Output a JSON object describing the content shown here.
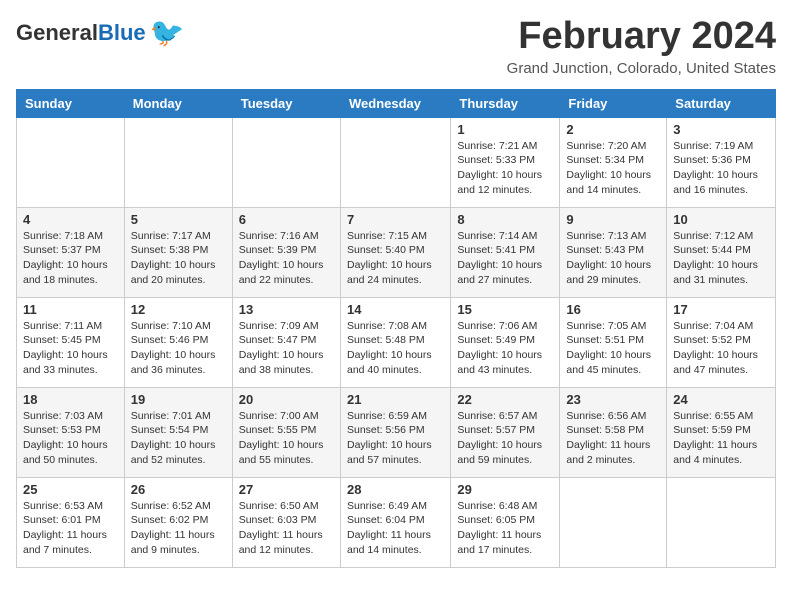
{
  "logo": {
    "general": "General",
    "blue": "Blue"
  },
  "title": {
    "month_year": "February 2024",
    "location": "Grand Junction, Colorado, United States"
  },
  "weekdays": [
    "Sunday",
    "Monday",
    "Tuesday",
    "Wednesday",
    "Thursday",
    "Friday",
    "Saturday"
  ],
  "weeks": [
    [
      {
        "day": "",
        "info": ""
      },
      {
        "day": "",
        "info": ""
      },
      {
        "day": "",
        "info": ""
      },
      {
        "day": "",
        "info": ""
      },
      {
        "day": "1",
        "info": "Sunrise: 7:21 AM\nSunset: 5:33 PM\nDaylight: 10 hours\nand 12 minutes."
      },
      {
        "day": "2",
        "info": "Sunrise: 7:20 AM\nSunset: 5:34 PM\nDaylight: 10 hours\nand 14 minutes."
      },
      {
        "day": "3",
        "info": "Sunrise: 7:19 AM\nSunset: 5:36 PM\nDaylight: 10 hours\nand 16 minutes."
      }
    ],
    [
      {
        "day": "4",
        "info": "Sunrise: 7:18 AM\nSunset: 5:37 PM\nDaylight: 10 hours\nand 18 minutes."
      },
      {
        "day": "5",
        "info": "Sunrise: 7:17 AM\nSunset: 5:38 PM\nDaylight: 10 hours\nand 20 minutes."
      },
      {
        "day": "6",
        "info": "Sunrise: 7:16 AM\nSunset: 5:39 PM\nDaylight: 10 hours\nand 22 minutes."
      },
      {
        "day": "7",
        "info": "Sunrise: 7:15 AM\nSunset: 5:40 PM\nDaylight: 10 hours\nand 24 minutes."
      },
      {
        "day": "8",
        "info": "Sunrise: 7:14 AM\nSunset: 5:41 PM\nDaylight: 10 hours\nand 27 minutes."
      },
      {
        "day": "9",
        "info": "Sunrise: 7:13 AM\nSunset: 5:43 PM\nDaylight: 10 hours\nand 29 minutes."
      },
      {
        "day": "10",
        "info": "Sunrise: 7:12 AM\nSunset: 5:44 PM\nDaylight: 10 hours\nand 31 minutes."
      }
    ],
    [
      {
        "day": "11",
        "info": "Sunrise: 7:11 AM\nSunset: 5:45 PM\nDaylight: 10 hours\nand 33 minutes."
      },
      {
        "day": "12",
        "info": "Sunrise: 7:10 AM\nSunset: 5:46 PM\nDaylight: 10 hours\nand 36 minutes."
      },
      {
        "day": "13",
        "info": "Sunrise: 7:09 AM\nSunset: 5:47 PM\nDaylight: 10 hours\nand 38 minutes."
      },
      {
        "day": "14",
        "info": "Sunrise: 7:08 AM\nSunset: 5:48 PM\nDaylight: 10 hours\nand 40 minutes."
      },
      {
        "day": "15",
        "info": "Sunrise: 7:06 AM\nSunset: 5:49 PM\nDaylight: 10 hours\nand 43 minutes."
      },
      {
        "day": "16",
        "info": "Sunrise: 7:05 AM\nSunset: 5:51 PM\nDaylight: 10 hours\nand 45 minutes."
      },
      {
        "day": "17",
        "info": "Sunrise: 7:04 AM\nSunset: 5:52 PM\nDaylight: 10 hours\nand 47 minutes."
      }
    ],
    [
      {
        "day": "18",
        "info": "Sunrise: 7:03 AM\nSunset: 5:53 PM\nDaylight: 10 hours\nand 50 minutes."
      },
      {
        "day": "19",
        "info": "Sunrise: 7:01 AM\nSunset: 5:54 PM\nDaylight: 10 hours\nand 52 minutes."
      },
      {
        "day": "20",
        "info": "Sunrise: 7:00 AM\nSunset: 5:55 PM\nDaylight: 10 hours\nand 55 minutes."
      },
      {
        "day": "21",
        "info": "Sunrise: 6:59 AM\nSunset: 5:56 PM\nDaylight: 10 hours\nand 57 minutes."
      },
      {
        "day": "22",
        "info": "Sunrise: 6:57 AM\nSunset: 5:57 PM\nDaylight: 10 hours\nand 59 minutes."
      },
      {
        "day": "23",
        "info": "Sunrise: 6:56 AM\nSunset: 5:58 PM\nDaylight: 11 hours\nand 2 minutes."
      },
      {
        "day": "24",
        "info": "Sunrise: 6:55 AM\nSunset: 5:59 PM\nDaylight: 11 hours\nand 4 minutes."
      }
    ],
    [
      {
        "day": "25",
        "info": "Sunrise: 6:53 AM\nSunset: 6:01 PM\nDaylight: 11 hours\nand 7 minutes."
      },
      {
        "day": "26",
        "info": "Sunrise: 6:52 AM\nSunset: 6:02 PM\nDaylight: 11 hours\nand 9 minutes."
      },
      {
        "day": "27",
        "info": "Sunrise: 6:50 AM\nSunset: 6:03 PM\nDaylight: 11 hours\nand 12 minutes."
      },
      {
        "day": "28",
        "info": "Sunrise: 6:49 AM\nSunset: 6:04 PM\nDaylight: 11 hours\nand 14 minutes."
      },
      {
        "day": "29",
        "info": "Sunrise: 6:48 AM\nSunset: 6:05 PM\nDaylight: 11 hours\nand 17 minutes."
      },
      {
        "day": "",
        "info": ""
      },
      {
        "day": "",
        "info": ""
      }
    ]
  ]
}
